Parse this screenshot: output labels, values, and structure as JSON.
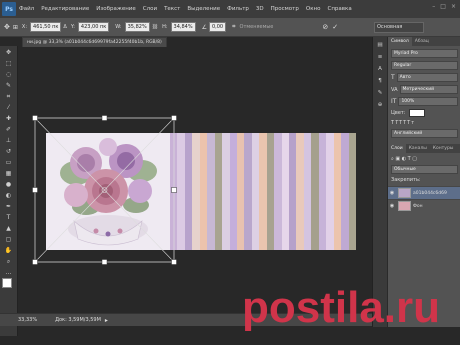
{
  "app": {
    "logo": "Ps"
  },
  "menu": [
    "Файл",
    "Редактирование",
    "Изображение",
    "Слои",
    "Текст",
    "Выделение",
    "Фильтр",
    "3D",
    "Просмотр",
    "Окно",
    "Справка"
  ],
  "window_controls": [
    "–",
    "□",
    "×"
  ],
  "options": {
    "x_label": "X:",
    "x_value": "461,50 пк",
    "y_label": "Y:",
    "y_value": "423,00 пк",
    "w_label": "W:",
    "w_value": "35,82%",
    "h_label": "H:",
    "h_value": "34,84%",
    "angle_value": "0,00",
    "interp_label": "Отменяемые",
    "workspace": "Основная"
  },
  "document_tab": "ни.jpg @ 33,3% (a01b044c6d69979fa42255f40b1b, RGB/8)",
  "status": {
    "zoom": "33,33%",
    "doc": "Док: 3,59М/3,59М"
  },
  "panel": {
    "tabs1": [
      "Символ",
      "Абзац"
    ],
    "font_value": "Myriad Pro",
    "font_style": "Regular",
    "size_value": "Авто",
    "kerning_value": "Метрический",
    "scale_value": "100%",
    "color_label": "Цвет:",
    "language": "Английский",
    "tabs2": [
      "Слои",
      "Каналы",
      "Контуры"
    ],
    "blend": "Обычные",
    "opacity_label": "Непрозрачность:",
    "lock_label": "Закрепить:",
    "layers": [
      {
        "name": "a01b044c6d69",
        "selected": true,
        "thumb": "#b9a6c7"
      },
      {
        "name": "Фон",
        "selected": false,
        "thumb": "#d9a7b1"
      }
    ]
  },
  "colors": {
    "accent": "#5d6e8a",
    "watermark": "#d0344a",
    "foreground": "#ffffff",
    "background": "#000000"
  },
  "stripes": [
    "#c9b2d7",
    "#dccbe4",
    "#b8a3cc",
    "#e7d2cc",
    "#ecc3ac",
    "#c7b8d4",
    "#a8a491",
    "#dbcfe3",
    "#c4aedb",
    "#e8c2b0",
    "#b9a7cc",
    "#ddd0e4",
    "#eac5af",
    "#a7a290",
    "#cbb8d9",
    "#e6d6ea",
    "#b6a1ca",
    "#e9c9bb",
    "#d4c4e1",
    "#a5a08d",
    "#c7b3d8",
    "#e2d1e8",
    "#ecc4ad",
    "#bfa9d3",
    "#a9a590"
  ],
  "watermark": {
    "text": "postila.ru"
  }
}
